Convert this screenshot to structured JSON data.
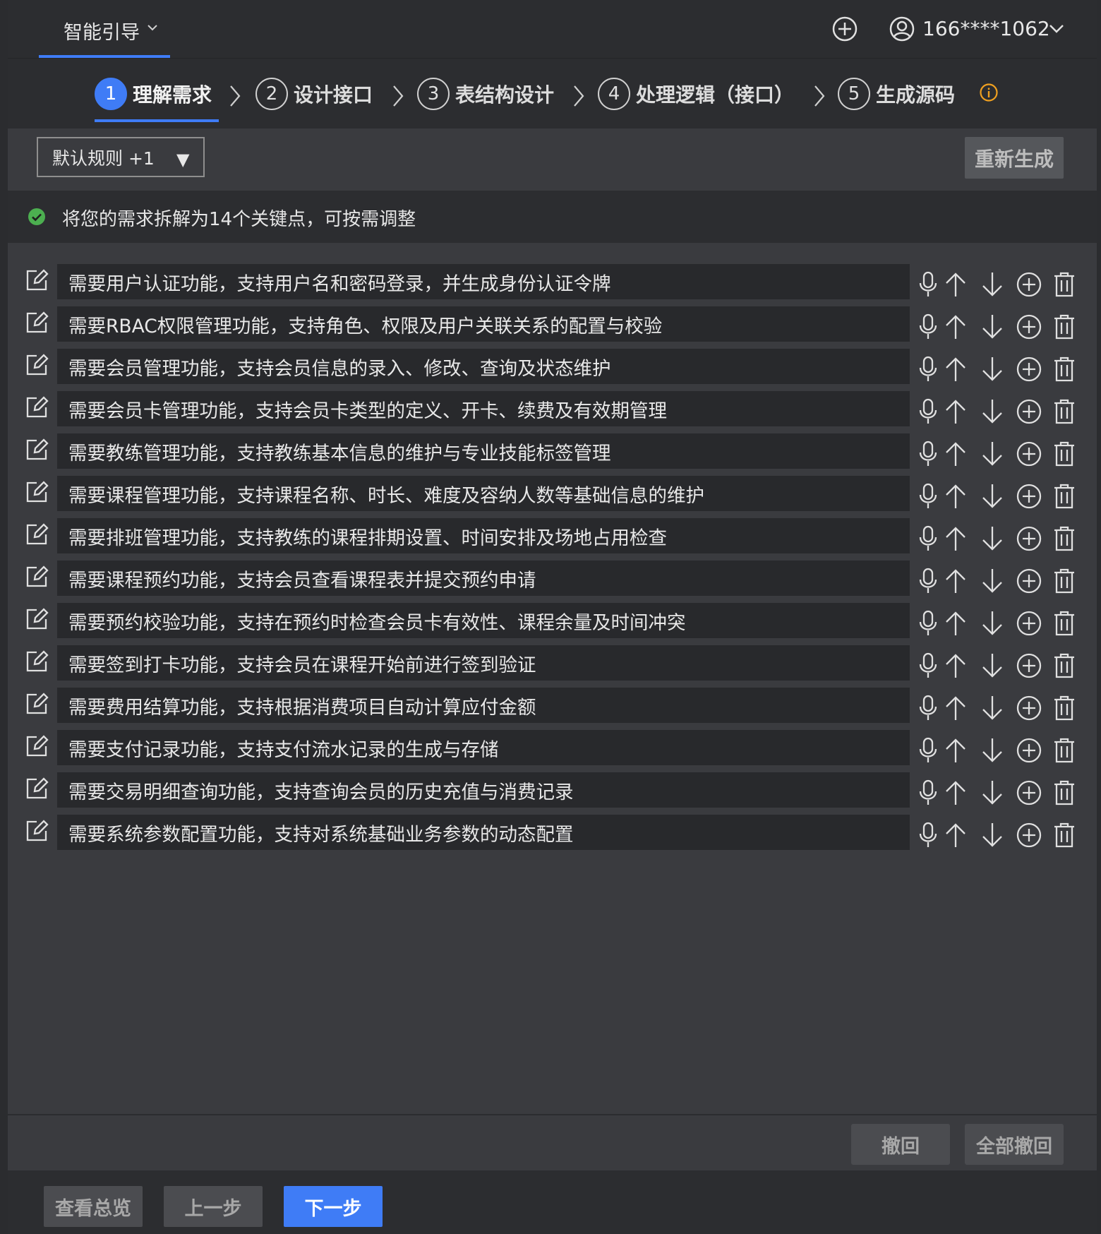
{
  "header": {
    "app_tab": "智能引导",
    "user": "166****1062"
  },
  "steps": [
    {
      "num": "1",
      "label": "理解需求"
    },
    {
      "num": "2",
      "label": "设计接口"
    },
    {
      "num": "3",
      "label": "表结构设计"
    },
    {
      "num": "4",
      "label": "处理逻辑（接口）"
    },
    {
      "num": "5",
      "label": "生成源码"
    }
  ],
  "toolbar": {
    "rule_select": "默认规则 +1",
    "rule_arrow": "▼",
    "regenerate": "重新生成"
  },
  "status": {
    "text": "将您的需求拆解为14个关键点，可按需调整",
    "color": "#4caf50"
  },
  "requirements": [
    "需要用户认证功能，支持用户名和密码登录，并生成身份认证令牌",
    "需要RBAC权限管理功能，支持角色、权限及用户关联关系的配置与校验",
    "需要会员管理功能，支持会员信息的录入、修改、查询及状态维护",
    "需要会员卡管理功能，支持会员卡类型的定义、开卡、续费及有效期管理",
    "需要教练管理功能，支持教练基本信息的维护与专业技能标签管理",
    "需要课程管理功能，支持课程名称、时长、难度及容纳人数等基础信息的维护",
    "需要排班管理功能，支持教练的课程排期设置、时间安排及场地占用检查",
    "需要课程预约功能，支持会员查看课程表并提交预约申请",
    "需要预约校验功能，支持在预约时检查会员卡有效性、课程余量及时间冲突",
    "需要签到打卡功能，支持会员在课程开始前进行签到验证",
    "需要费用结算功能，支持根据消费项目自动计算应付金额",
    "需要支付记录功能，支持支付流水记录的生成与存储",
    "需要交易明细查询功能，支持查询会员的历史充值与消费记录",
    "需要系统参数配置功能，支持对系统基础业务参数的动态配置"
  ],
  "row_actions": [
    "microphone-icon",
    "arrow-up-icon",
    "arrow-down-icon",
    "add-circle-icon",
    "trash-icon"
  ],
  "undo": {
    "undo": "撤回",
    "undo_all": "全部撤回"
  },
  "footer": {
    "overview": "查看总览",
    "prev": "上一步",
    "next": "下一步"
  },
  "colors": {
    "accent": "#3f7cf6",
    "info": "#f0a020"
  }
}
